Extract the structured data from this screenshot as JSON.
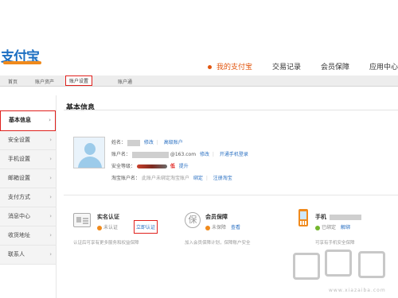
{
  "header": {
    "logo_text": "支付宝",
    "nav": [
      {
        "label": "我的支付宝",
        "active": true
      },
      {
        "label": "交易记录",
        "active": false
      },
      {
        "label": "会员保障",
        "active": false
      },
      {
        "label": "应用中心",
        "active": false
      }
    ]
  },
  "subnav": {
    "items": [
      {
        "label": "首页"
      },
      {
        "label": "账户资产"
      },
      {
        "label": "账户设置",
        "selected": true
      },
      {
        "label": "账户通"
      }
    ]
  },
  "sidebar": {
    "items": [
      {
        "label": "基本信息",
        "selected": true
      },
      {
        "label": "安全设置"
      },
      {
        "label": "手机设置"
      },
      {
        "label": "邮箱设置"
      },
      {
        "label": "支付方式"
      },
      {
        "label": "消息中心"
      },
      {
        "label": "收货地址"
      },
      {
        "label": "联系人"
      }
    ],
    "chevron": "›"
  },
  "main": {
    "title": "基本信息",
    "profile": {
      "name_label": "姓名：",
      "name_links": [
        "修改",
        "高级账户"
      ],
      "account_label": "账户名：",
      "account_value": "@163.com",
      "account_links": [
        "修改",
        "开通手机登录"
      ],
      "security_label": "安全等级：",
      "security_level": "低",
      "security_link": "提升",
      "alias_label": "淘宝账户名：",
      "alias_value": "此账户未绑定淘宝账户",
      "alias_links": [
        "绑定",
        "注册淘宝"
      ]
    },
    "cards": [
      {
        "title": "实名认证",
        "status": "未认证",
        "action": "立即认证",
        "desc": "认证后可享有更多服务和权益保障"
      },
      {
        "title": "会员保障",
        "status": "未保障",
        "action": "查看",
        "desc": "加入会员保障计划，保障账户安全"
      },
      {
        "title": "手机",
        "status": "已绑定",
        "action": "解绑",
        "desc": "可享有手机安全保障"
      }
    ]
  },
  "watermark": {
    "text": "www.xiazaiba.com"
  },
  "colors": {
    "accent": "#e2560f",
    "link": "#2a70c2",
    "highlight": "#e0201c",
    "brand": "#1d6fc2"
  }
}
